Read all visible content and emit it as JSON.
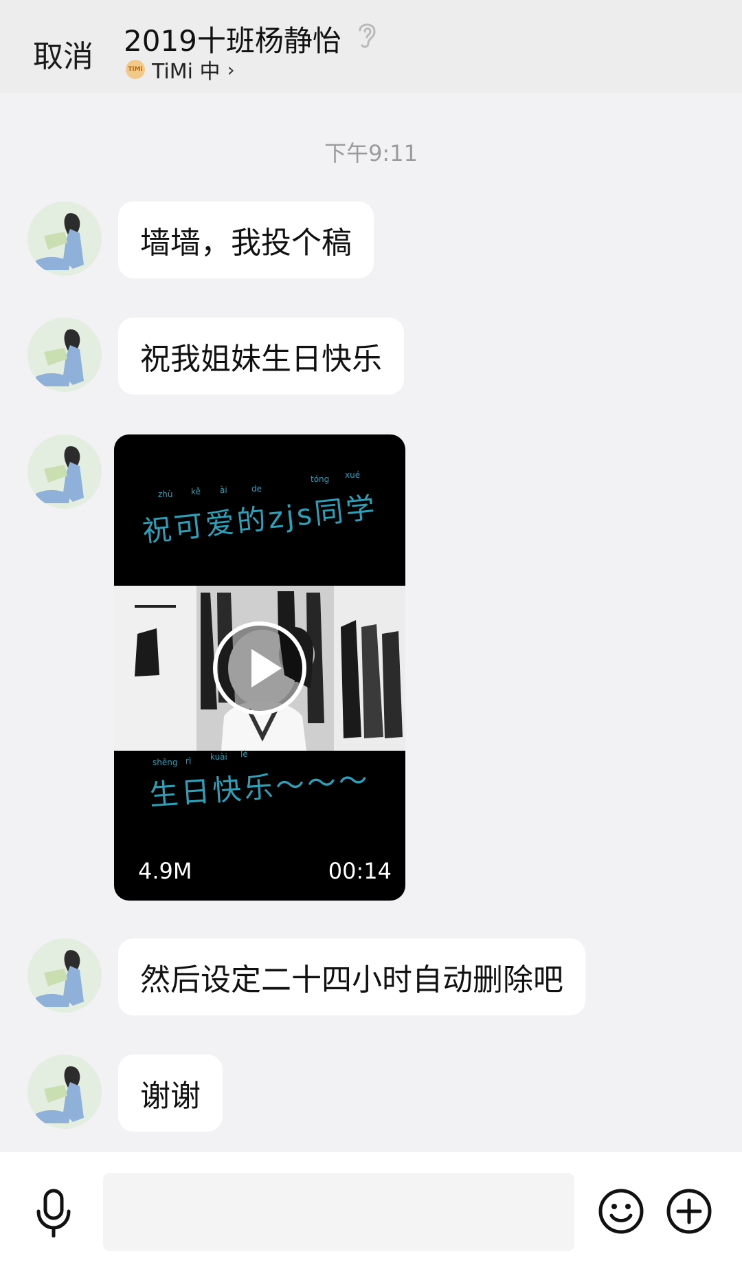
{
  "header": {
    "cancel_label": "取消",
    "title": "2019十班杨静怡",
    "status_app_badge": "TiMi",
    "status_text": "TiMi 中",
    "ear_icon": "ear-icon",
    "chevron_icon": "chevron-right-icon"
  },
  "timestamp": "下午9:11",
  "messages": [
    {
      "type": "text",
      "text": "墙墙，我投个稿"
    },
    {
      "type": "text",
      "text": "祝我姐妹生日快乐"
    },
    {
      "type": "video",
      "top_caption": "祝可爱的zjs同学",
      "top_pinyin": [
        "zhù",
        "kě",
        "ài",
        "de",
        "tóng",
        "xué"
      ],
      "bottom_caption": "生日快乐～～～",
      "bottom_pinyin": [
        "shēng",
        "rì",
        "kuài",
        "lè"
      ],
      "size": "4.9M",
      "duration": "00:14"
    },
    {
      "type": "text",
      "text": "然后设定二十四小时自动删除吧"
    },
    {
      "type": "text",
      "text": "谢谢"
    }
  ],
  "inputbar": {
    "mic_icon": "microphone-icon",
    "input_value": "",
    "emoji_icon": "emoji-icon",
    "plus_icon": "plus-icon"
  },
  "colors": {
    "background": "#f2f1f3",
    "bubble": "#ffffff",
    "caption_teal": "#2f9fb8"
  }
}
